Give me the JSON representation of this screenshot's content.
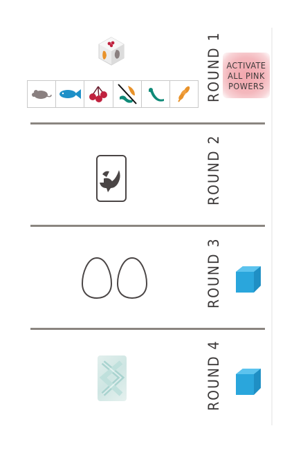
{
  "rounds": [
    {
      "label": "ROUND 1",
      "goal": "food-dice-strip"
    },
    {
      "label": "ROUND 2",
      "goal": "bird-card"
    },
    {
      "label": "ROUND 3",
      "goal": "two-eggs"
    },
    {
      "label": "ROUND 4",
      "goal": "bonus-card"
    }
  ],
  "round1": {
    "pink_text": [
      "ACTIVATE",
      "ALL PINK",
      "POWERS"
    ],
    "food_icons": [
      "rodent-icon",
      "fish-icon",
      "fruit-icon",
      "invertebrate-or-seed-icon",
      "invertebrate-icon",
      "wheat-icon"
    ]
  },
  "colors": {
    "pink": "#f4b8bd",
    "cube": "#2aa6dc",
    "divider": "#8a8580",
    "text": "#3b3838",
    "fish": "#1e90c8",
    "fruit": "#c0223f",
    "wheat": "#e8922a",
    "invertebrate": "#0f8a78",
    "rodent": "#8a8080"
  }
}
